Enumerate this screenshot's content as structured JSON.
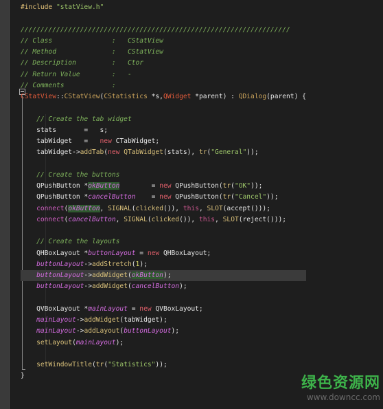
{
  "editor": {
    "lines": [
      [
        {
          "t": "#include ",
          "c": "t-pp"
        },
        {
          "t": "\"statView.h\"",
          "c": "t-str"
        }
      ],
      [],
      [
        {
          "t": "////////////////////////////////////////////////////////////////////",
          "c": "t-cmt"
        }
      ],
      [
        {
          "t": "// Class               :   CStatView",
          "c": "t-cmt"
        }
      ],
      [
        {
          "t": "// Method              :   CStatView",
          "c": "t-cmt"
        }
      ],
      [
        {
          "t": "// Description         :   Ctor",
          "c": "t-cmt"
        }
      ],
      [
        {
          "t": "// Return Value        :   -",
          "c": "t-cmt"
        }
      ],
      [
        {
          "t": "// Comments            :",
          "c": "t-cmt"
        }
      ],
      [
        {
          "t": "CStatView",
          "c": "t-red"
        },
        {
          "t": "::",
          "c": "t-def"
        },
        {
          "t": "CStatView",
          "c": "t-cls"
        },
        {
          "t": "(",
          "c": "t-def"
        },
        {
          "t": "CStatistics",
          "c": "t-cls"
        },
        {
          "t": " *s,",
          "c": "t-def"
        },
        {
          "t": "QWidget",
          "c": "t-red"
        },
        {
          "t": " *parent) : ",
          "c": "t-def"
        },
        {
          "t": "QDialog",
          "c": "t-cls"
        },
        {
          "t": "(parent) {",
          "c": "t-def"
        }
      ],
      [],
      [
        {
          "t": "    // Create the tab widget",
          "c": "t-cmt"
        }
      ],
      [
        {
          "t": "    stats       =   s;",
          "c": "t-def"
        }
      ],
      [
        {
          "t": "    tabWidget   =   ",
          "c": "t-def"
        },
        {
          "t": "new",
          "c": "t-kw"
        },
        {
          "t": " CTabWidget;",
          "c": "t-def"
        }
      ],
      [
        {
          "t": "    tabWidget->",
          "c": "t-def"
        },
        {
          "t": "addTab",
          "c": "t-ext"
        },
        {
          "t": "(",
          "c": "t-def"
        },
        {
          "t": "new",
          "c": "t-kw"
        },
        {
          "t": " ",
          "c": "t-def"
        },
        {
          "t": "QTabWidget",
          "c": "t-ext"
        },
        {
          "t": "(stats), ",
          "c": "t-def"
        },
        {
          "t": "tr",
          "c": "t-ext"
        },
        {
          "t": "(",
          "c": "t-def"
        },
        {
          "t": "\"General\"",
          "c": "t-str"
        },
        {
          "t": "));",
          "c": "t-def"
        }
      ],
      [],
      [
        {
          "t": "    // Create the buttons",
          "c": "t-cmt"
        }
      ],
      [
        {
          "t": "    QPushButton *",
          "c": "t-def"
        },
        {
          "t": "okButton",
          "c": "t-var-hl"
        },
        {
          "t": "        = ",
          "c": "t-def"
        },
        {
          "t": "new",
          "c": "t-kw"
        },
        {
          "t": " QPushButton(",
          "c": "t-def"
        },
        {
          "t": "tr",
          "c": "t-ext"
        },
        {
          "t": "(",
          "c": "t-def"
        },
        {
          "t": "\"OK\"",
          "c": "t-str"
        },
        {
          "t": "));",
          "c": "t-def"
        }
      ],
      [
        {
          "t": "    QPushButton *",
          "c": "t-def"
        },
        {
          "t": "cancelButton",
          "c": "t-var"
        },
        {
          "t": "    = ",
          "c": "t-def"
        },
        {
          "t": "new",
          "c": "t-kw"
        },
        {
          "t": " QPushButton(",
          "c": "t-def"
        },
        {
          "t": "tr",
          "c": "t-ext"
        },
        {
          "t": "(",
          "c": "t-def"
        },
        {
          "t": "\"Cancel\"",
          "c": "t-str"
        },
        {
          "t": "));",
          "c": "t-def"
        }
      ],
      [
        {
          "t": "    ",
          "c": "t-def"
        },
        {
          "t": "connect",
          "c": "t-fn"
        },
        {
          "t": "(",
          "c": "t-def"
        },
        {
          "t": "okButton",
          "c": "t-var-hl"
        },
        {
          "t": ", ",
          "c": "t-def"
        },
        {
          "t": "SIGNAL",
          "c": "t-ext"
        },
        {
          "t": "(",
          "c": "t-def"
        },
        {
          "t": "clicked",
          "c": "t-ext"
        },
        {
          "t": "()), ",
          "c": "t-def"
        },
        {
          "t": "this",
          "c": "t-kw2"
        },
        {
          "t": ", ",
          "c": "t-def"
        },
        {
          "t": "SLOT",
          "c": "t-ext"
        },
        {
          "t": "(accept()));",
          "c": "t-def"
        }
      ],
      [
        {
          "t": "    ",
          "c": "t-def"
        },
        {
          "t": "connect",
          "c": "t-fn"
        },
        {
          "t": "(",
          "c": "t-def"
        },
        {
          "t": "cancelButton",
          "c": "t-var"
        },
        {
          "t": ", ",
          "c": "t-def"
        },
        {
          "t": "SIGNAL",
          "c": "t-ext"
        },
        {
          "t": "(",
          "c": "t-def"
        },
        {
          "t": "clicked",
          "c": "t-ext"
        },
        {
          "t": "()), ",
          "c": "t-def"
        },
        {
          "t": "this",
          "c": "t-kw2"
        },
        {
          "t": ", ",
          "c": "t-def"
        },
        {
          "t": "SLOT",
          "c": "t-ext"
        },
        {
          "t": "(reject()));",
          "c": "t-def"
        }
      ],
      [],
      [
        {
          "t": "    // Create the layouts",
          "c": "t-cmt"
        }
      ],
      [
        {
          "t": "    QHBoxLayout *",
          "c": "t-def"
        },
        {
          "t": "buttonLayout",
          "c": "t-var"
        },
        {
          "t": " = ",
          "c": "t-def"
        },
        {
          "t": "new",
          "c": "t-kw"
        },
        {
          "t": " QHBoxLayout;",
          "c": "t-def"
        }
      ],
      [
        {
          "t": "    ",
          "c": "t-def"
        },
        {
          "t": "buttonLayout",
          "c": "t-var"
        },
        {
          "t": "->",
          "c": "t-def"
        },
        {
          "t": "addStretch",
          "c": "t-ext"
        },
        {
          "t": "(",
          "c": "t-def"
        },
        {
          "t": "1",
          "c": "t-num"
        },
        {
          "t": ");",
          "c": "t-def"
        }
      ],
      [
        {
          "t": "    ",
          "c": "t-def"
        },
        {
          "t": "buttonLayout",
          "c": "t-var"
        },
        {
          "t": "->",
          "c": "t-def"
        },
        {
          "t": "addWidget",
          "c": "t-ext"
        },
        {
          "t": "(",
          "c": "t-def"
        },
        {
          "t": "okButton",
          "c": "t-var-hl"
        },
        {
          "t": ");",
          "c": "t-def"
        }
      ],
      [
        {
          "t": "    ",
          "c": "t-def"
        },
        {
          "t": "buttonLayout",
          "c": "t-var"
        },
        {
          "t": "->",
          "c": "t-def"
        },
        {
          "t": "addWidget",
          "c": "t-ext"
        },
        {
          "t": "(",
          "c": "t-def"
        },
        {
          "t": "cancelButton",
          "c": "t-var"
        },
        {
          "t": ");",
          "c": "t-def"
        }
      ],
      [],
      [
        {
          "t": "    QVBoxLayout *",
          "c": "t-def"
        },
        {
          "t": "mainLayout",
          "c": "t-var"
        },
        {
          "t": " = ",
          "c": "t-def"
        },
        {
          "t": "new",
          "c": "t-kw"
        },
        {
          "t": " QVBoxLayout;",
          "c": "t-def"
        }
      ],
      [
        {
          "t": "    ",
          "c": "t-def"
        },
        {
          "t": "mainLayout",
          "c": "t-var"
        },
        {
          "t": "->",
          "c": "t-def"
        },
        {
          "t": "addWidget",
          "c": "t-ext"
        },
        {
          "t": "(tabWidget);",
          "c": "t-def"
        }
      ],
      [
        {
          "t": "    ",
          "c": "t-def"
        },
        {
          "t": "mainLayout",
          "c": "t-var"
        },
        {
          "t": "->",
          "c": "t-def"
        },
        {
          "t": "addLayout",
          "c": "t-ext"
        },
        {
          "t": "(",
          "c": "t-def"
        },
        {
          "t": "buttonLayout",
          "c": "t-var"
        },
        {
          "t": ");",
          "c": "t-def"
        }
      ],
      [
        {
          "t": "    ",
          "c": "t-def"
        },
        {
          "t": "setLayout",
          "c": "t-ext"
        },
        {
          "t": "(",
          "c": "t-def"
        },
        {
          "t": "mainLayout",
          "c": "t-var"
        },
        {
          "t": ");",
          "c": "t-def"
        }
      ],
      [],
      [
        {
          "t": "    ",
          "c": "t-def"
        },
        {
          "t": "setWindowTitle",
          "c": "t-ext"
        },
        {
          "t": "(",
          "c": "t-def"
        },
        {
          "t": "tr",
          "c": "t-ext"
        },
        {
          "t": "(",
          "c": "t-def"
        },
        {
          "t": "\"Statistics\"",
          "c": "t-str"
        },
        {
          "t": "));",
          "c": "t-def"
        }
      ],
      [
        {
          "t": "}",
          "c": "t-def"
        }
      ]
    ],
    "highlighted_line": 24
  },
  "watermark": {
    "site_name_cn": "绿色资源网",
    "url": "www.downcc.com"
  },
  "colors": {
    "background": "#1e1e1e",
    "comment": "#7fb35c",
    "string": "#9ec76a",
    "keyword": "#e05f6a"
  }
}
